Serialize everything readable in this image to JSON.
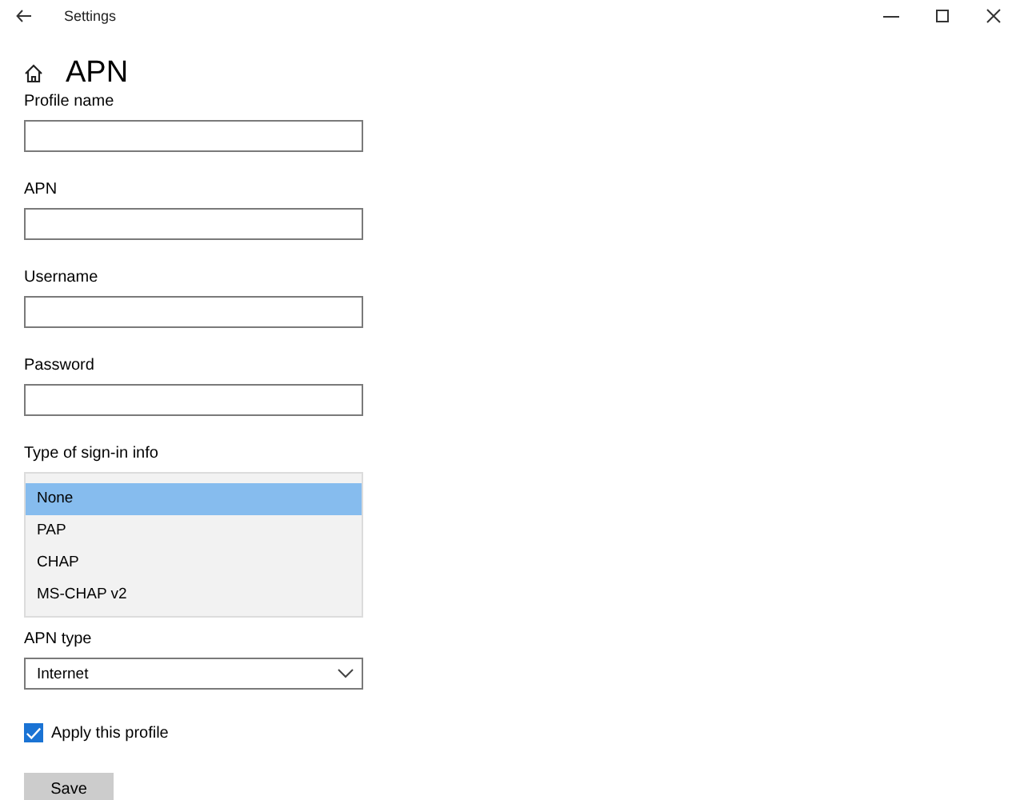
{
  "window": {
    "title": "Settings"
  },
  "heading": "APN",
  "fields": [
    {
      "label": "Profile name"
    },
    {
      "label": "APN"
    },
    {
      "label": "Username"
    },
    {
      "label": "Password"
    }
  ],
  "sign_in": {
    "label": "Type of sign-in info",
    "options": [
      {
        "label": "None",
        "selected": true
      },
      {
        "label": "PAP",
        "selected": false
      },
      {
        "label": "CHAP",
        "selected": false
      },
      {
        "label": "MS-CHAP v2",
        "selected": false
      }
    ]
  },
  "apn_type": {
    "label": "APN type",
    "value": "Internet"
  },
  "apply": {
    "label": "Apply this profile",
    "checked": true
  },
  "save": "Save"
}
